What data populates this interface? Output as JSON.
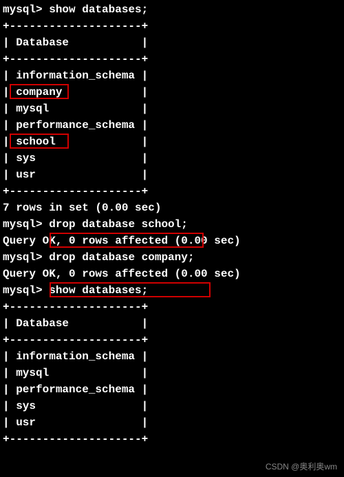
{
  "terminal": {
    "prompt": "mysql>",
    "cmd_show_db": "show databases;",
    "border_top": "+--------------------+",
    "header_line": "| Database           |",
    "db1_rows": [
      "| information_schema |",
      "| company            |",
      "| mysql              |",
      "| performance_schema |",
      "| school             |",
      "| sys                |",
      "| usr                |"
    ],
    "result_7rows": "7 rows in set (0.00 sec)",
    "blank": "",
    "cmd_drop_school": "drop database school;",
    "query_ok": "Query OK, 0 rows affected (0.00 sec)",
    "cmd_drop_company": "drop database company;",
    "db2_rows": [
      "| information_schema |",
      "| mysql              |",
      "| performance_schema |",
      "| sys                |",
      "| usr                |"
    ]
  },
  "highlights": {
    "company": "company",
    "school": "school",
    "drop_school": "drop database school;",
    "drop_company": "drop database company;"
  },
  "watermark": "CSDN @奥利奥wm"
}
